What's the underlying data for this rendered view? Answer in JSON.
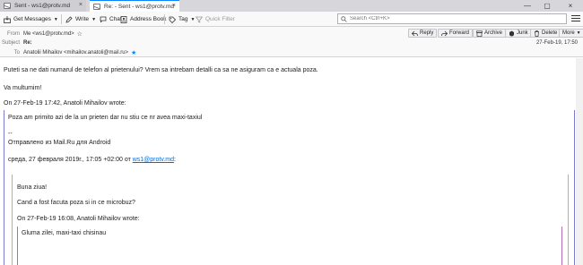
{
  "tabs": [
    {
      "label": "Sent - ws1@protv.md",
      "close": "×"
    },
    {
      "label": "Re: - Sent - ws1@protv.md",
      "close": "×"
    }
  ],
  "window_controls": {
    "minimize": "—",
    "maximize": "▢",
    "close": "×"
  },
  "toolbar": {
    "get_messages": "Get Messages",
    "write": "Write",
    "chat": "Chat",
    "address_book": "Address Book",
    "tag": "Tag",
    "quick_filter": "Quick Filter",
    "search_placeholder": "Search <Ctrl+K>"
  },
  "header": {
    "from_label": "From",
    "from_value": "Me <ws1@protv.md>",
    "subject_label": "Subject",
    "subject_value": "Re:",
    "to_label": "To",
    "to_value": "Anatolii Mihailov <mihailov.anatoli@mail.ru>",
    "date": "27-Feb-19, 17:50",
    "actions": {
      "reply": "Reply",
      "forward": "Forward",
      "archive": "Archive",
      "junk": "Junk",
      "delete": "Delete",
      "more": "More"
    }
  },
  "message": {
    "line1": "Puteti sa ne dati numarul de telefon al prietenului? Vrem sa intrebam detalli ca sa ne asiguram ca e actuala poza.",
    "line2": "Va multumim!",
    "quote1_header": "On 27-Feb-19 17:42, Anatoli Mihailov wrote:",
    "quote1_line1": "Poza am primito azi de la un prieten dar nu stiu ce nr avea maxi-taxiul",
    "quote1_sig_dashes": "--",
    "quote1_sig": "Отправлено из Mail.Ru для Android",
    "quote1_date_prefix": "среда, 27 февраля 2019г., 17:05 +02:00 от ",
    "quote1_date_link": "ws1@protv.md",
    "quote1_date_suffix": ":",
    "quote2_line1": "Buna ziua!",
    "quote2_line2": "Cand a fost facuta poza si in ce microbuz?",
    "quote2_header": "On 27-Feb-19 16:08, Anatoli Mihailov wrote:",
    "quote3_line1": "Gluma zilei, maxi-taxi chisinau"
  },
  "colors": {
    "accent": "#0a84ff",
    "quote1_bar": "#7a7ad0",
    "quote2_bar": "#c99cc9",
    "quote3_bar": "#b36fb3"
  }
}
